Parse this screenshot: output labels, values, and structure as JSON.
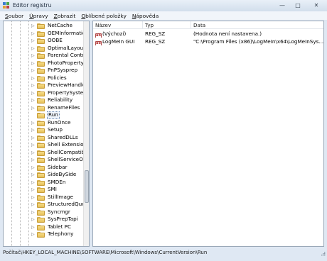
{
  "window": {
    "title": "Editor registru"
  },
  "menu": [
    {
      "accel": "S",
      "rest": "oubor"
    },
    {
      "accel": "Ú",
      "rest": "pravy"
    },
    {
      "accel": "Z",
      "rest": "obrazit"
    },
    {
      "accel": "O",
      "rest": "blíbené položky"
    },
    {
      "accel": "N",
      "rest": "ápověda"
    }
  ],
  "tree": {
    "selected": "Run",
    "items": [
      "NetCache",
      "OEMInformation",
      "OOBE",
      "OptimalLayout",
      "Parental Controls",
      "PhotoPropertyHandler",
      "PnPSysprep",
      "Policies",
      "PreviewHandlers",
      "PropertySystem",
      "Reliability",
      "RenameFiles",
      "Run",
      "RunOnce",
      "Setup",
      "SharedDLLs",
      "Shell Extensions",
      "ShellCompatibility",
      "ShellServiceObjects",
      "Sidebar",
      "SideBySide",
      "SMDEn",
      "SMI",
      "StillImage",
      "StructuredQuery",
      "Syncmgr",
      "SysPrepTapi",
      "Tablet PC",
      "Telephony"
    ]
  },
  "list": {
    "columns": {
      "name": "Název",
      "type": "Typ",
      "data": "Data"
    },
    "rows": [
      {
        "name": "(Výchozí)",
        "type": "REG_SZ",
        "data": "(Hodnota není nastavena.)"
      },
      {
        "name": "LogMeIn GUI",
        "type": "REG_SZ",
        "data": "\"C:\\Program Files (x86)\\LogMeIn\\x64\\LogMeInSys..."
      }
    ]
  },
  "statusbar": {
    "path": "Počítač\\HKEY_LOCAL_MACHINE\\SOFTWARE\\Microsoft\\Windows\\CurrentVersion\\Run"
  },
  "icons": {
    "value": "ab-icon",
    "folder": "folder-icon",
    "expand": "expand-arrow-icon"
  },
  "colors": {
    "titlebar": "#dfe8f3",
    "selection_border": "#6f8db4",
    "folder": "#e4be57"
  }
}
